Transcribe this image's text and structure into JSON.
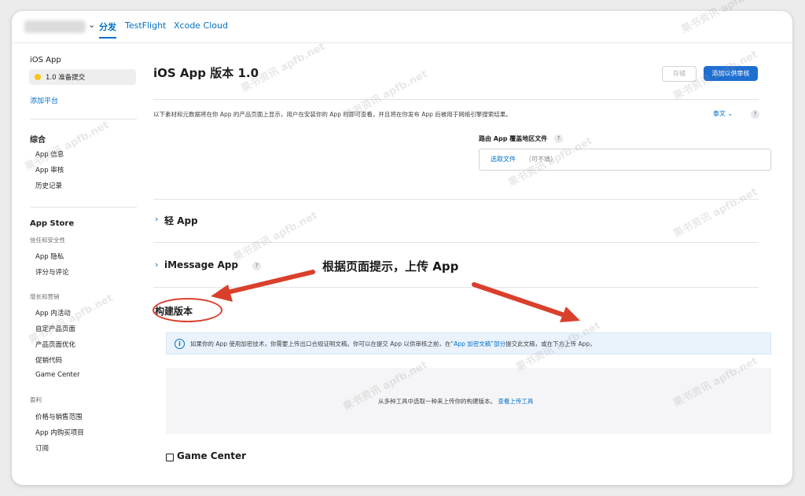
{
  "topbar": {
    "tabs": [
      "分发",
      "TestFlight",
      "Xcode Cloud"
    ]
  },
  "sidebar": {
    "platform_title": "iOS App",
    "version_label": "1.0 准备提交",
    "add_platform": "添加平台",
    "groups": [
      {
        "title": "综合",
        "items": [
          "App 信息",
          "App 审核",
          "历史记录"
        ]
      },
      {
        "title": "App Store",
        "sub1": "信任和安全性",
        "items1": [
          "App 隐私",
          "评分与评论"
        ],
        "sub2": "增长和营销",
        "items2": [
          "App 内活动",
          "自定产品页面",
          "产品页面优化",
          "促销代码",
          "Game Center"
        ],
        "sub3": "盈利",
        "items3": [
          "价格与销售范围",
          "App 内购买项目",
          "订阅"
        ]
      }
    ]
  },
  "main": {
    "title": "iOS App 版本 1.0",
    "save_label": "存储",
    "submit_label": "添加以供审核",
    "description": "以下素材和元数据将在你 App 的产品页面上显示，用户在安装你的 App 时即可查看，并且将在你发布 App 后被用于网络引擎搜索结果。",
    "language": "泰文",
    "route_label": "路由 App 覆盖地区文件",
    "route_choose": "选取文件",
    "route_optional": "（可不填）",
    "sections": [
      "轻 App",
      "iMessage App"
    ],
    "build_title": "构建版本",
    "info_pre": "如果你的 App 使用加密技术，你需要上传出口合规证明文稿。你可以在提交 App 以供审核之前，在",
    "info_link": "“App 加密文稿”部分",
    "info_post": "提交此文稿，或在下方上传 App。",
    "upload_text": "从多种工具中选取一种来上传你的构建版本。",
    "upload_link": "查看上传工具",
    "game_center": "Game Center"
  },
  "annotation": {
    "text": "根据页面提示，上传 App",
    "color": "#d9402c"
  },
  "watermark": "果书资讯 apfb.net"
}
